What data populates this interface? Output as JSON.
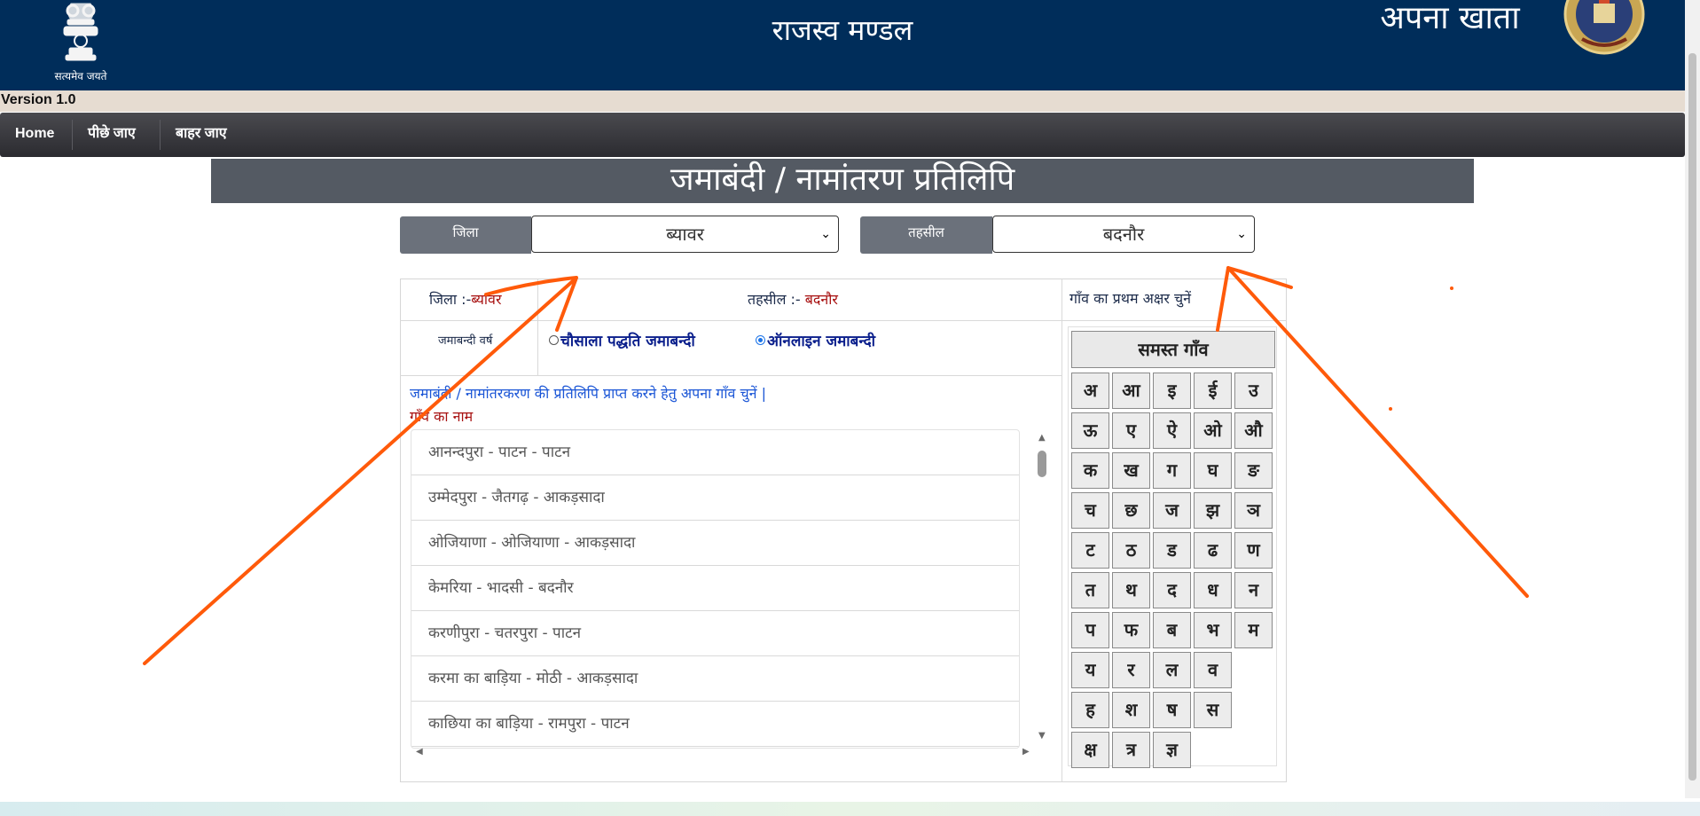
{
  "header": {
    "motto": "सत्यमेव जयते",
    "site_title": "राजस्व मण्डल",
    "app_title": "अपना खाता"
  },
  "version": "Version 1.0",
  "nav": {
    "home": "Home",
    "back": "पीछे जाए",
    "exit": "बाहर जाए"
  },
  "page_title": "जमाबंदी / नामांतरण प्रतिलिपि",
  "district": {
    "label": "जिला",
    "selected": "ब्यावर"
  },
  "tehsil": {
    "label": "तहसील",
    "selected": "बदनौर"
  },
  "info": {
    "district_prefix": "जिला :-",
    "district_value": "ब्यावर",
    "tehsil_prefix": "तहसील :-",
    "tehsil_value": "बदनौर",
    "year_label": "जमाबन्दी वर्ष",
    "radio_chausala": "चौसाला पद्धति जमाबन्दी",
    "radio_online": "ऑनलाइन जमाबन्दी",
    "selected_radio": "online",
    "instruction": "जमाबंदी / नामांतरकरण की प्रतिलिपि प्राप्त करने हेतु अपना गाँव चुनें |",
    "village_heading": "गाँव का नाम"
  },
  "villages": [
    "आनन्दपुरा - पाटन - पाटन",
    "उम्मेदपुरा - जैतगढ़ - आकड़सादा",
    "ओजियाणा - ओजियाणा - आकड़सादा",
    "केमरिया - भादसी - बदनौर",
    "करणीपुरा - चतरपुरा - पाटन",
    "करमा का बाड़िया - मोठी - आकड़सादा",
    "काछिया का बाड़िया - रामपुरा - पाटन"
  ],
  "letters": {
    "title": "गाँव का प्रथम अक्षर चुनें",
    "all_button": "समस्त गाँव",
    "rows": [
      [
        "अ",
        "आ",
        "इ",
        "ई",
        "उ"
      ],
      [
        "ऊ",
        "ए",
        "ऐ",
        "ओ",
        "औ"
      ],
      [
        "क",
        "ख",
        "ग",
        "घ",
        "ङ"
      ],
      [
        "च",
        "छ",
        "ज",
        "झ",
        "ञ"
      ],
      [
        "ट",
        "ठ",
        "ड",
        "ढ",
        "ण"
      ],
      [
        "त",
        "थ",
        "द",
        "ध",
        "न"
      ],
      [
        "प",
        "फ",
        "ब",
        "भ",
        "म"
      ],
      [
        "य",
        "र",
        "ल",
        "व"
      ],
      [
        "ह",
        "श",
        "ष",
        "स"
      ],
      [
        "क्ष",
        "त्र",
        "ज्ञ"
      ]
    ]
  },
  "colors": {
    "header_bg": "#002d5a",
    "nav_bg": "#2b2b30",
    "title_band": "#545a63",
    "annotation": "#ff5a0a",
    "link_blue": "#1a55d6",
    "value_red": "#a71010"
  }
}
